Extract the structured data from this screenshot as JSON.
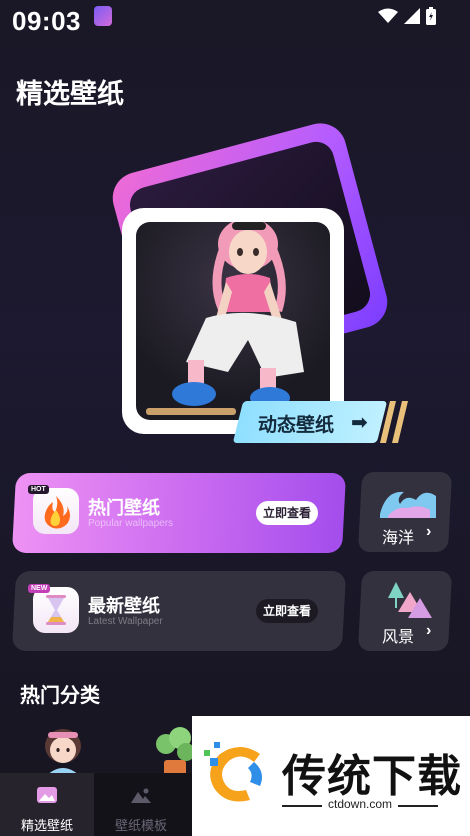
{
  "status_bar": {
    "time": "09:03"
  },
  "header": {
    "title": "精选壁纸"
  },
  "hero": {
    "tag_label": "动态壁纸",
    "tag_arrow": "➡"
  },
  "cards": {
    "hot": {
      "badge": "HOT",
      "title": "热门壁纸",
      "subtitle": "Popular wallpapers",
      "button": "立即查看"
    },
    "new": {
      "badge": "NEW",
      "title": "最新壁纸",
      "subtitle": "Latest Wallpaper",
      "button": "立即查看"
    }
  },
  "mini_cards": {
    "sea": {
      "label": "海洋",
      "arrow": "›"
    },
    "scene": {
      "label": "风景",
      "arrow": "›"
    }
  },
  "section": {
    "title": "热门分类"
  },
  "bottom_nav": {
    "items": [
      {
        "label": "精选壁纸"
      },
      {
        "label": "壁纸模板"
      }
    ]
  },
  "watermark": {
    "title": "传统下载",
    "url": "ctdown.com"
  },
  "colors": {
    "accent": "#c96af0",
    "background": "#1a1726",
    "tag": "#8fdfff"
  }
}
